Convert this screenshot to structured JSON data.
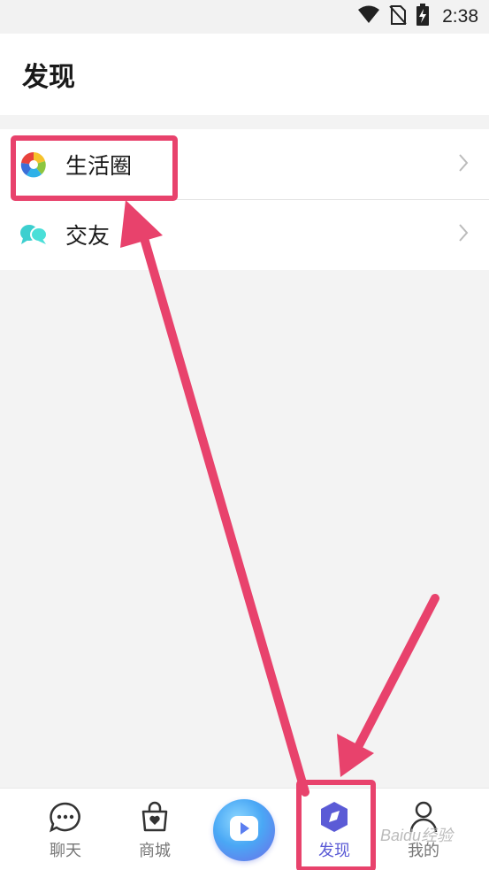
{
  "status_bar": {
    "time": "2:38"
  },
  "header": {
    "title": "发现"
  },
  "list": {
    "items": [
      {
        "label": "生活圈",
        "icon": "colorful-pinwheel-icon"
      },
      {
        "label": "交友",
        "icon": "chat-bubbles-icon"
      }
    ]
  },
  "bottom_nav": {
    "items": [
      {
        "label": "聊天",
        "icon": "chat-bubble-icon"
      },
      {
        "label": "商城",
        "icon": "shopping-bag-icon"
      },
      {
        "label": "",
        "icon": "play-button-icon"
      },
      {
        "label": "发现",
        "icon": "compass-hexagon-icon",
        "active": true
      },
      {
        "label": "我的",
        "icon": "person-icon"
      }
    ]
  },
  "colors": {
    "accent": "#5b5bd6",
    "annotation": "#e8426c",
    "background": "#f3f3f3"
  },
  "watermark": "Baidu经验"
}
